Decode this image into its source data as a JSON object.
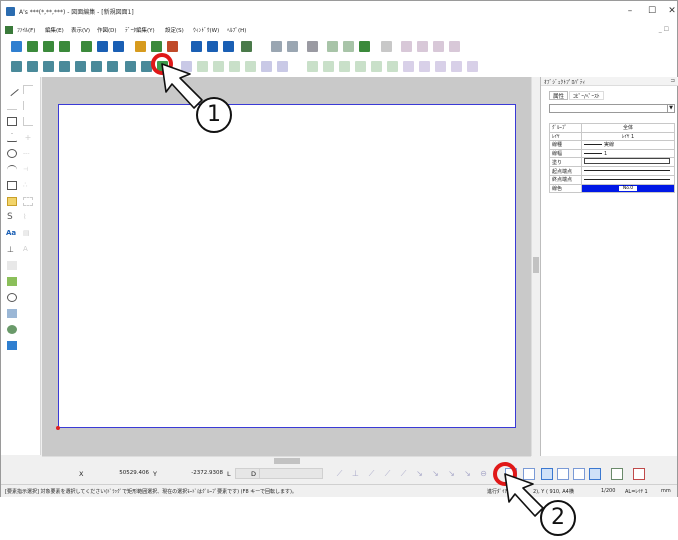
{
  "window": {
    "title": "A's ***(*,**,***) - 図面編集 - [新規図面1]",
    "controls": {
      "minimize": "–",
      "maximize": "☐",
      "close": "✕"
    }
  },
  "menu": {
    "items": [
      "ﾌｧｲﾙ(F)",
      "編集(E)",
      "表示(V)",
      "作図(D)",
      "ﾃﾞｰﾀ編集(Y)",
      "設定(S)",
      "ｳｨﾝﾄﾞｳ(W)",
      "ﾍﾙﾌﾟ(H)"
    ],
    "restore_small": "_ ☐"
  },
  "properties_panel": {
    "title": "ｵﾌﾞｼﾞｪｸﾄﾌﾟﾛﾊﾟﾃｨ",
    "pin": "⊐",
    "tabs": [
      "属性",
      "ｺﾋﾟｰ/ﾍﾟｰｽﾄ"
    ],
    "rows": [
      {
        "key": "ｸﾞﾙｰﾌﾟ",
        "value": "全体"
      },
      {
        "key": "ﾚｲﾔ",
        "value": "ﾚｲﾔ 1"
      },
      {
        "key": "線種",
        "value": "実線"
      },
      {
        "key": "線幅",
        "value": "1"
      },
      {
        "key": "塗り",
        "value": ""
      },
      {
        "key": "起点端点",
        "value": ""
      },
      {
        "key": "終点端点",
        "value": ""
      },
      {
        "key": "線色",
        "value": "No.0"
      }
    ],
    "line_color": "#0018e6"
  },
  "status": {
    "x_label": "X",
    "x_value": "50529.406",
    "y_label": "Y",
    "y_value": "-2372.9308",
    "l_label": "L",
    "l_value": "",
    "d_label": "D",
    "d_value": ""
  },
  "info_bar": {
    "message": "[要素指示選択] 対象要素を選択してください(ﾄﾞﾗｯｸﾞで矩形範囲選択、現在の選択ﾓｰﾄﾞはｸﾞﾙｰﾌﾟ要素です) (F8 キーで回転します)。",
    "paper": "進行ﾀﾞｲｱ",
    "size": "2), Y ( 910, A4横",
    "scale": "1/200",
    "layer": "AL=ﾚｲﾔ 1",
    "unit": "mm"
  },
  "callouts": [
    "1",
    "2"
  ],
  "colors": {
    "highlight": "#e01818",
    "paper_border": "#3a3ad6",
    "canvas_bg": "#c9c9c9"
  }
}
